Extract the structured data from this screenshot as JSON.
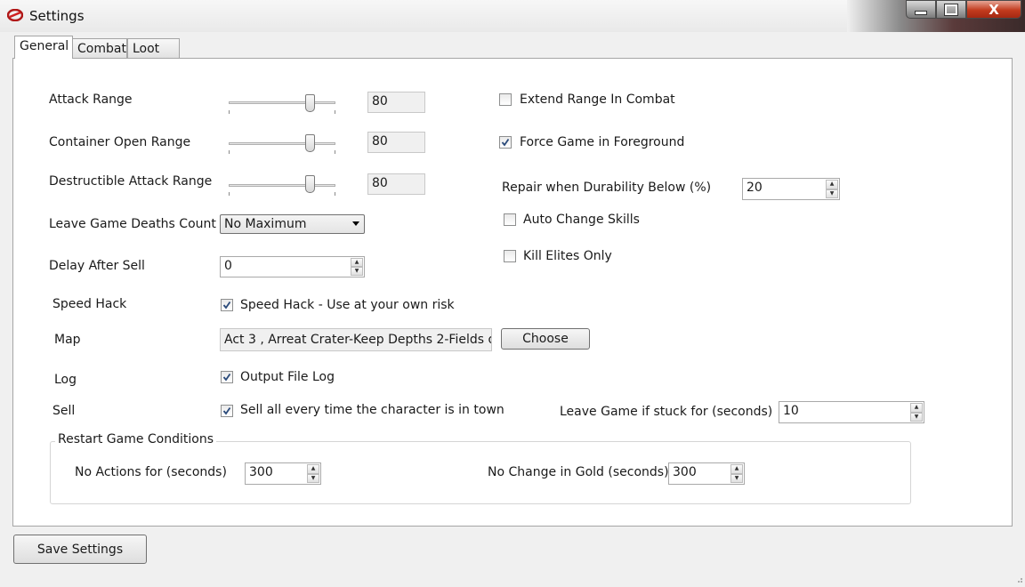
{
  "window": {
    "title": "Settings",
    "close_glyph": "X"
  },
  "icons": {
    "app": "app-logo-icon",
    "minimize": "minimize-icon",
    "maximize": "maximize-icon",
    "close": "close-icon"
  },
  "tabs": [
    {
      "label": "General",
      "active": true
    },
    {
      "label": "Combat",
      "active": false
    },
    {
      "label": "Loot",
      "active": false
    }
  ],
  "general": {
    "attack_range": {
      "label": "Attack Range",
      "value": "80",
      "slider_fraction": 0.8
    },
    "container_open_range": {
      "label": "Container Open Range",
      "value": "80",
      "slider_fraction": 0.8
    },
    "destructible_attack_range": {
      "label": "Destructible Attack Range",
      "value": "80",
      "slider_fraction": 0.8
    },
    "leave_game_deaths": {
      "label": "Leave Game Deaths Count",
      "selected": "No Maximum"
    },
    "delay_after_sell": {
      "label": "Delay After Sell",
      "value": "0"
    },
    "speed_hack": {
      "label": "Speed Hack",
      "checkbox_label": "Speed Hack - Use at your own risk",
      "checked": true
    },
    "map": {
      "label": "Map",
      "value": "Act 3 , Arreat Crater-Keep Depths 2-Fields o",
      "button": "Choose"
    },
    "log": {
      "label": "Log",
      "checkbox_label": "Output File Log",
      "checked": true
    },
    "sell": {
      "label": "Sell",
      "checkbox_label": "Sell all every time the character is in town",
      "checked": true
    },
    "extend_range_in_combat": {
      "label": "Extend Range In Combat",
      "checked": false
    },
    "force_game_in_foreground": {
      "label": "Force Game in Foreground",
      "checked": true
    },
    "repair_durability": {
      "label": "Repair when Durability Below (%)",
      "value": "20"
    },
    "auto_change_skills": {
      "label": "Auto Change Skills",
      "checked": false
    },
    "kill_elites_only": {
      "label": "Kill Elites Only",
      "checked": false
    },
    "leave_game_if_stuck": {
      "label": "Leave Game if stuck for (seconds)",
      "value": "10"
    },
    "restart_conditions": {
      "title": "Restart Game Conditions",
      "no_actions": {
        "label": "No Actions for (seconds)",
        "value": "300"
      },
      "no_gold_change": {
        "label": "No Change in Gold (seconds)",
        "value": "300"
      }
    }
  },
  "footer": {
    "save_button": "Save Settings"
  }
}
